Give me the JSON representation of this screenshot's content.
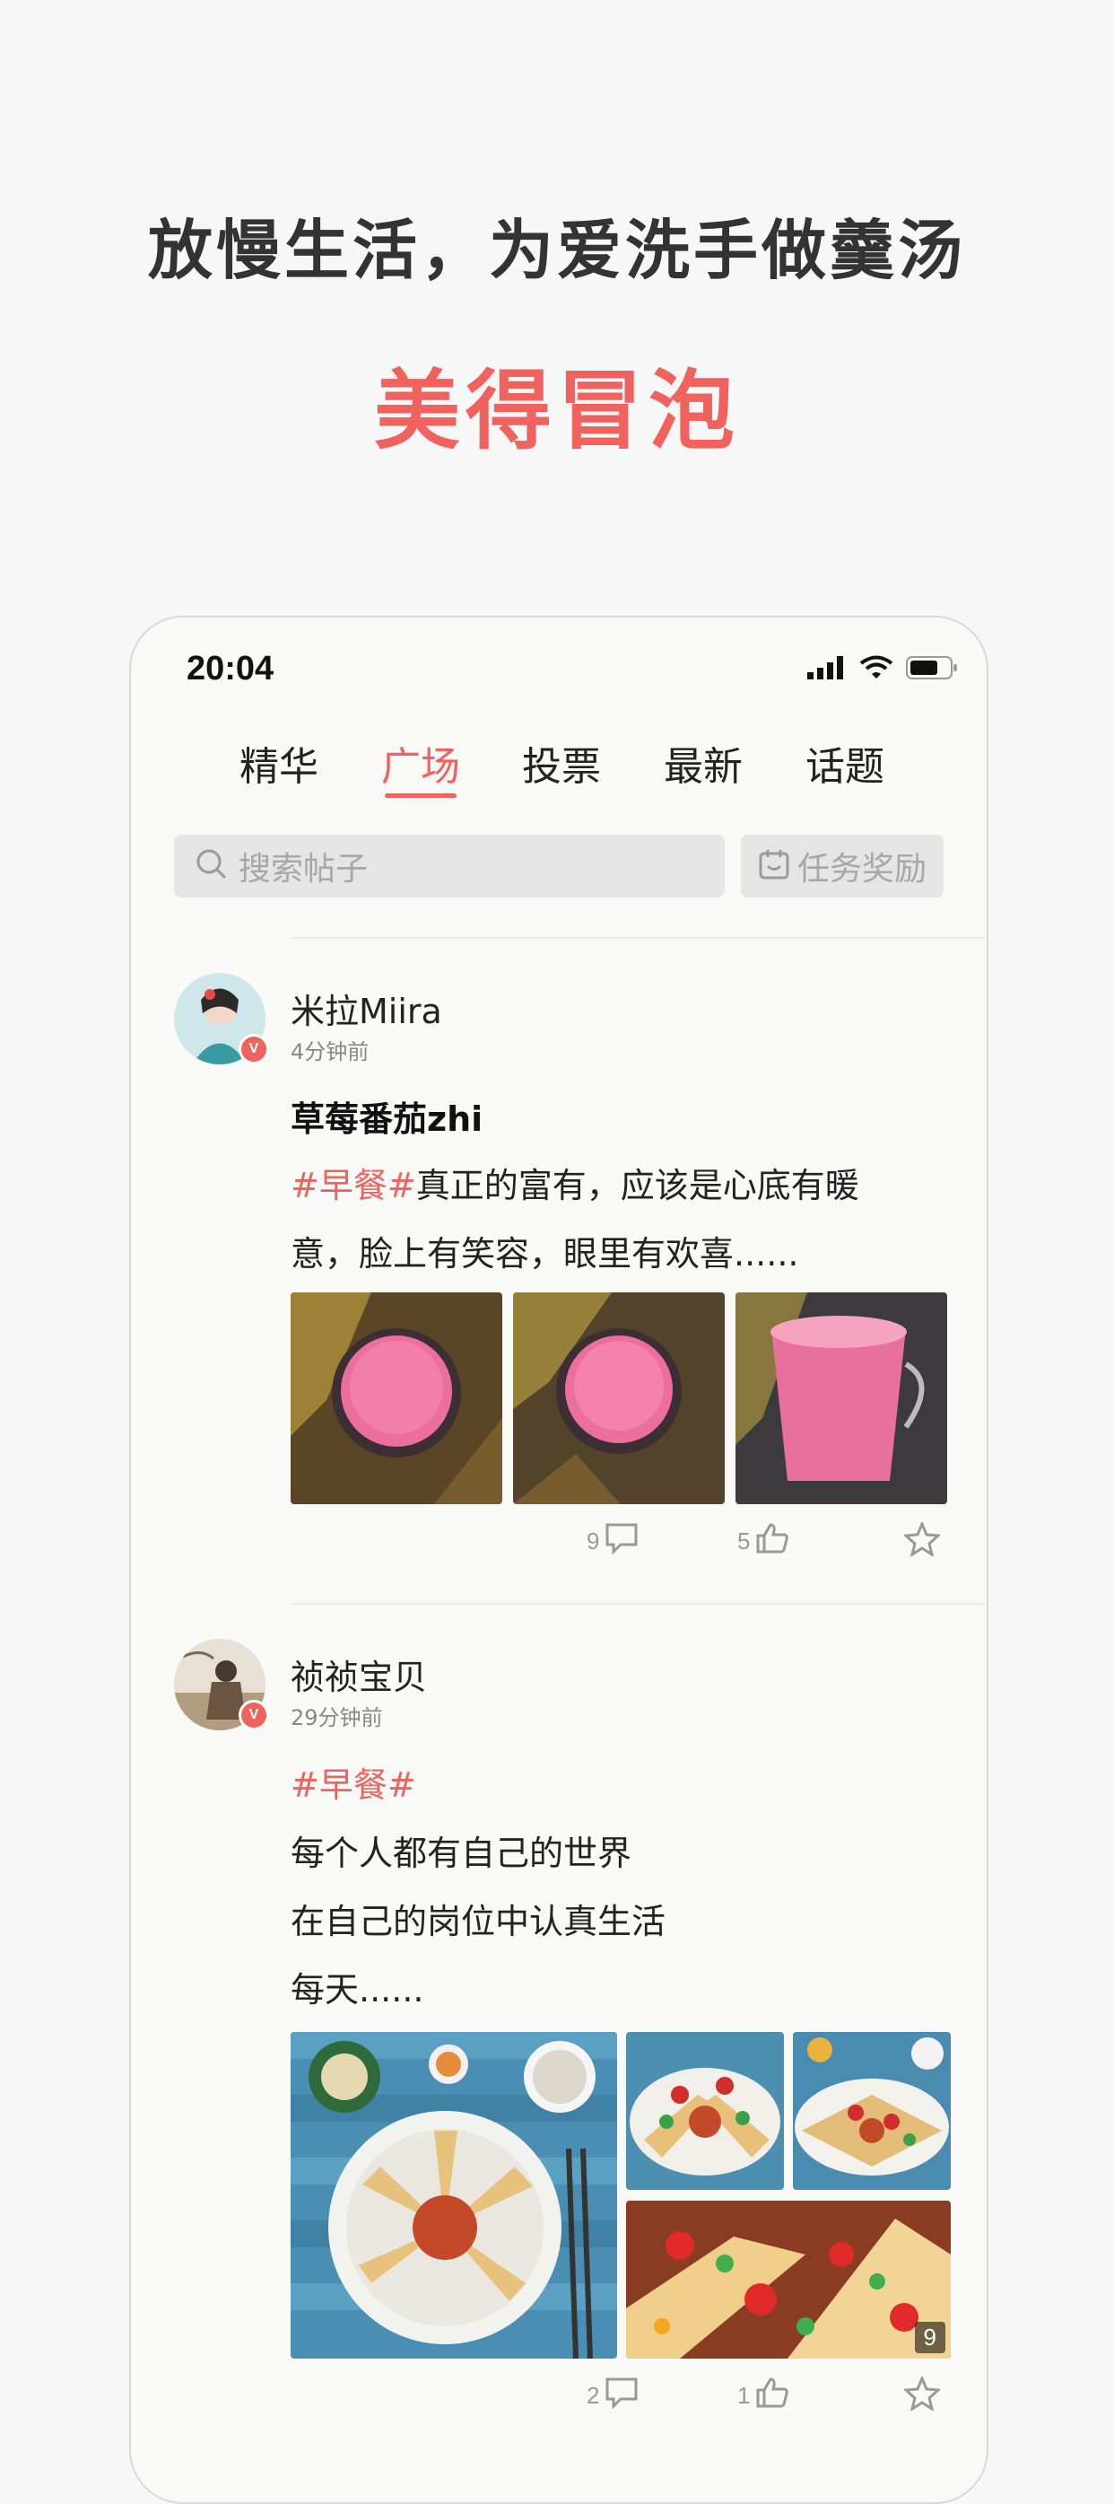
{
  "promo": {
    "headline_line1": "放慢生活，为爱洗手做羹汤",
    "headline_line2": "美得冒泡",
    "accent_color": "#f0625d"
  },
  "status_bar": {
    "time": "20:04",
    "icons": [
      "signal-bars-icon",
      "wifi-icon",
      "battery-icon"
    ]
  },
  "tabs": [
    {
      "label": "精华",
      "active": false
    },
    {
      "label": "广场",
      "active": true
    },
    {
      "label": "投票",
      "active": false
    },
    {
      "label": "最新",
      "active": false
    },
    {
      "label": "话题",
      "active": false
    }
  ],
  "search": {
    "placeholder": "搜索帖子",
    "task_reward_label": "任务奖励"
  },
  "posts": [
    {
      "username": "米拉Miira",
      "time_ago": "4分钟前",
      "title": "草莓番茄zhi",
      "hashtag": "#早餐#",
      "body_lines": [
        "真正的富有，应该是心底有暖",
        "意，脸上有笑容，眼里有欢喜......"
      ],
      "verified_badge": "V",
      "comments": "9",
      "likes": "5"
    },
    {
      "username": "祯祯宝贝",
      "time_ago": "29分钟前",
      "hashtag": "#早餐#",
      "body_lines": [
        "每个人都有自己的世界",
        "在自己的岗位中认真生活",
        "每天......"
      ],
      "verified_badge": "V",
      "image_count": "9",
      "comments": "2",
      "likes": "1"
    }
  ]
}
